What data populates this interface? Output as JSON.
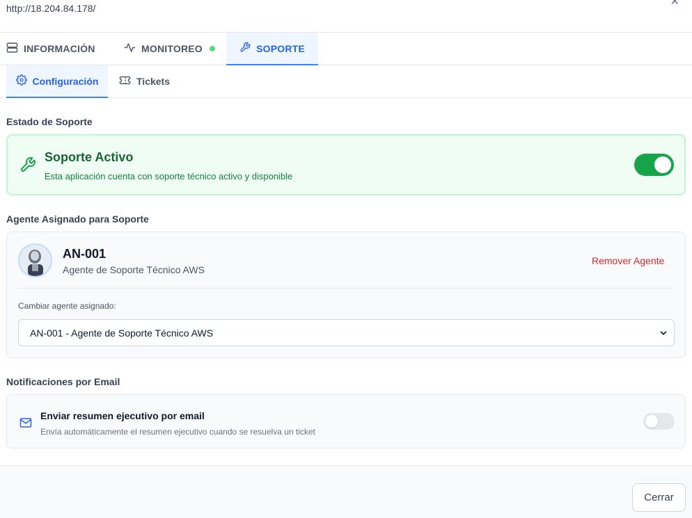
{
  "url": "http://18.204.84.178/",
  "main_tabs": [
    {
      "label": "INFORMACIÓN",
      "icon": "server-icon"
    },
    {
      "label": "MONITOREO",
      "icon": "activity-icon",
      "status_color": "#4ade80"
    },
    {
      "label": "SOPORTE",
      "icon": "wrench-icon",
      "active": true
    }
  ],
  "sub_tabs": [
    {
      "label": "Configuración",
      "icon": "gear-icon",
      "active": true
    },
    {
      "label": "Tickets",
      "icon": "ticket-icon"
    }
  ],
  "support_status": {
    "section_label": "Estado de Soporte",
    "title": "Soporte Activo",
    "description": "Esta aplicación cuenta con soporte técnico activo y disponible",
    "enabled": true
  },
  "agent": {
    "section_label": "Agente Asignado para Soporte",
    "name": "AN-001",
    "role": "Agente de Soporte Técnico AWS",
    "remove_label": "Remover Agente",
    "change_label": "Cambiar agente asignado:",
    "selected_option": "AN-001 - Agente de Soporte Técnico AWS"
  },
  "notifications": {
    "section_label": "Notificaciones por Email",
    "title": "Enviar resumen ejecutivo por email",
    "description": "Envía automáticamente el resumen ejecutivo cuando se resuelva un ticket",
    "enabled": false
  },
  "footer": {
    "close_label": "Cerrar"
  },
  "colors": {
    "accent": "#2563eb",
    "success": "#16a34a",
    "danger": "#dc2626"
  }
}
